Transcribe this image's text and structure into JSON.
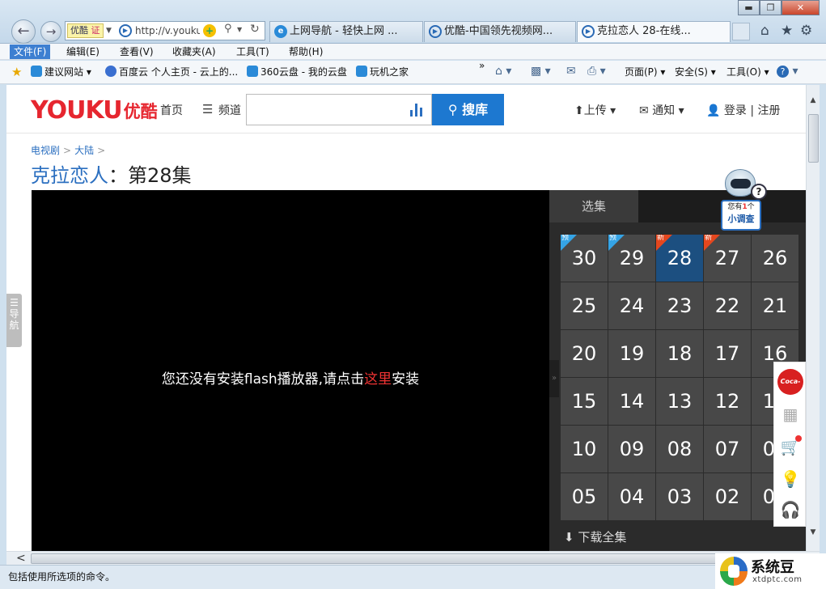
{
  "browser": {
    "address_cert": "优酷",
    "address_cert_badge": "证",
    "address_url": "http://v.youku",
    "tabs": [
      {
        "label": "上网导航 - 轻快上网 ..."
      },
      {
        "label": "优酷-中国领先视频网..."
      },
      {
        "label": "克拉恋人 28-在线..."
      }
    ],
    "menu": [
      {
        "label": "文件(F)"
      },
      {
        "label": "编辑(E)"
      },
      {
        "label": "查看(V)"
      },
      {
        "label": "收藏夹(A)"
      },
      {
        "label": "工具(T)"
      },
      {
        "label": "帮助(H)"
      }
    ],
    "favorites": [
      {
        "label": "建议网站 ▾"
      },
      {
        "label": "百度云 个人主页 - 云上的..."
      },
      {
        "label": "360云盘 - 我的云盘"
      },
      {
        "label": "玩机之家"
      }
    ],
    "commands": {
      "overflow": "»",
      "page": "页面(P) ▾",
      "safety": "安全(S) ▾",
      "tools": "工具(O) ▾"
    },
    "status": "包括使用所选项的命令。"
  },
  "youku": {
    "logo_en": "YOUKU",
    "logo_cn": "优酷",
    "nav_home": "首页",
    "nav_channels": "频道",
    "search_button": "搜库",
    "upload": "上传 ▾",
    "notify": "通知 ▾",
    "login": "登录 | 注册",
    "breadcrumb": [
      "电视剧",
      "大陆"
    ],
    "title_show": "克拉恋人",
    "title_sep": "：",
    "title_episode": "第28集",
    "flash_msg_before": "您还没有安装flash播放器,请点击",
    "flash_msg_link": "这里",
    "flash_msg_after": "安装",
    "side_tab": "选集",
    "episodes": [
      {
        "num": "30",
        "tag": "预"
      },
      {
        "num": "29",
        "tag": "预"
      },
      {
        "num": "28",
        "tag": "新"
      },
      {
        "num": "27",
        "tag": "新"
      },
      {
        "num": "26",
        "tag": ""
      },
      {
        "num": "25",
        "tag": ""
      },
      {
        "num": "24",
        "tag": ""
      },
      {
        "num": "23",
        "tag": ""
      },
      {
        "num": "22",
        "tag": ""
      },
      {
        "num": "21",
        "tag": ""
      },
      {
        "num": "20",
        "tag": ""
      },
      {
        "num": "19",
        "tag": ""
      },
      {
        "num": "18",
        "tag": ""
      },
      {
        "num": "17",
        "tag": ""
      },
      {
        "num": "16",
        "tag": ""
      },
      {
        "num": "15",
        "tag": ""
      },
      {
        "num": "14",
        "tag": ""
      },
      {
        "num": "13",
        "tag": ""
      },
      {
        "num": "12",
        "tag": ""
      },
      {
        "num": "11",
        "tag": ""
      },
      {
        "num": "10",
        "tag": ""
      },
      {
        "num": "09",
        "tag": ""
      },
      {
        "num": "08",
        "tag": ""
      },
      {
        "num": "07",
        "tag": ""
      },
      {
        "num": "06",
        "tag": ""
      },
      {
        "num": "05",
        "tag": ""
      },
      {
        "num": "04",
        "tag": ""
      },
      {
        "num": "03",
        "tag": ""
      },
      {
        "num": "02",
        "tag": ""
      },
      {
        "num": "01",
        "tag": ""
      }
    ],
    "current_episode": "28",
    "download_all": "下载全集",
    "survey_line1_a": "您有",
    "survey_line1_b": "1",
    "survey_line1_c": "个",
    "survey_line2": "小调查",
    "side_nav": "导航",
    "coke_label": "Coca-Cola"
  },
  "watermark": {
    "name": "系统豆",
    "url": "xtdptc.com"
  },
  "colors": {
    "youku_red": "#e6262f",
    "youku_blue": "#1d78d0",
    "current_episode": "#1c4f80",
    "tag_preview": "#35a4e6",
    "tag_new": "#e5471e"
  }
}
